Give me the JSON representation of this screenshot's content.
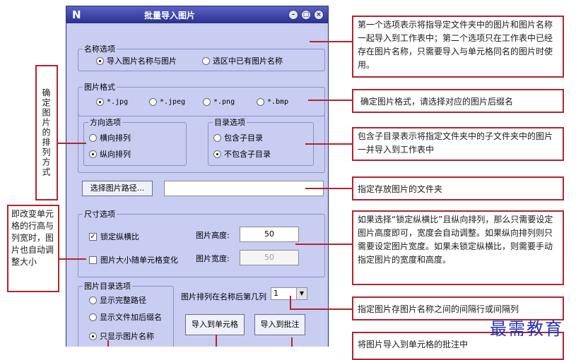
{
  "window": {
    "logo": "N",
    "title": "批量导入图片",
    "controls": {
      "minimize": "–",
      "restore": "□",
      "close": "×"
    }
  },
  "name_options": {
    "legend": "名称选项",
    "items": [
      {
        "label": "导入图片名称与图片",
        "selected": true
      },
      {
        "label": "选区中已有图片名称",
        "selected": false
      }
    ]
  },
  "image_format": {
    "legend": "图片格式",
    "items": [
      {
        "label": "*.jpg",
        "selected": true
      },
      {
        "label": "*.jpeg",
        "selected": false
      },
      {
        "label": "*.png",
        "selected": false
      },
      {
        "label": "*.bmp",
        "selected": false
      }
    ]
  },
  "direction": {
    "legend": "方向选项",
    "items": [
      {
        "label": "横向排列",
        "selected": false
      },
      {
        "label": "纵向排列",
        "selected": true
      }
    ]
  },
  "directory": {
    "legend": "目录选项",
    "items": [
      {
        "label": "包含子目录",
        "selected": false
      },
      {
        "label": "不包含子目录",
        "selected": true
      }
    ]
  },
  "path": {
    "button_label": "选择图片路径...",
    "value": ""
  },
  "size": {
    "legend": "尺寸选项",
    "lock_ratio": {
      "label": "锁定纵横比",
      "checked": true
    },
    "fit_cell": {
      "label": "图片大小随单元格变化",
      "checked": false
    },
    "height_label": "图片高度:",
    "height_value": "50",
    "width_label": "图片宽度:",
    "width_value": "50"
  },
  "catalog": {
    "legend": "图片目录选项",
    "items": [
      {
        "label": "显示完整路径",
        "selected": false
      },
      {
        "label": "显示文件加后缀名",
        "selected": false
      },
      {
        "label": "只显示图片名称",
        "selected": true
      }
    ]
  },
  "column_after": {
    "label": "图片排列在名称后第几列",
    "value": "1"
  },
  "buttons": {
    "import_cell": "导入到单元格",
    "import_comment": "导入到批注"
  },
  "callouts": {
    "name_options": "第一个选项表示将指导定文件夹中的图片和图片名称一起导入到工作表中；第二个选项只在工作表中已经存在图片名称，只需要导入与单元格同名的图片时使用。",
    "image_format": "确定图片格式，请选择对应的图片后缀名",
    "directory": "包含子目录表示将指定文件夹中的子文件夹中的图片一并导入到工作表中",
    "path": "指定存放图片的文件夹",
    "size": "如果选择“锁定纵横比”且纵向排列，那么只需要设定图片高度即可，宽度会自动调整。如果纵向排列则只需要设定图片宽度。如果未锁定纵横比，则需要手动指定图片的宽度和高度。",
    "column_after": "指定图片存图片名称之间的间隔行或间隔列",
    "bottom_partial": "将图片导入到单元格的批注中",
    "direction_vertical": "确定图片的排列方式",
    "fit_cell_vertical": "即改变单元格的行高与列宽时，图片也自动调整大小"
  },
  "watermark": "最需教育"
}
